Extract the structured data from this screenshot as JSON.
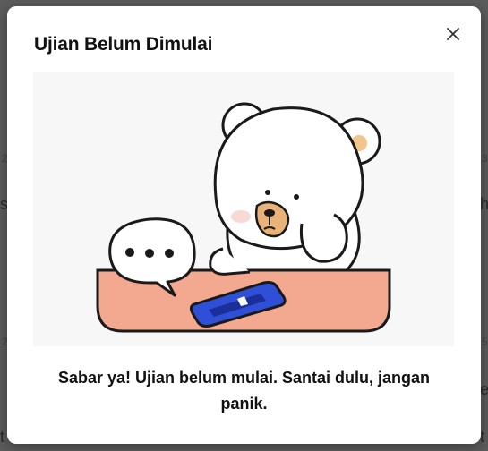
{
  "dialog": {
    "title": "Ujian Belum Dimulai",
    "message": "Sabar ya! Ujian belum mulai. Santai dulu, jangan panik.",
    "close_icon": "close-icon"
  },
  "illustration": {
    "subject": "bear-waiting-illustration",
    "icons": [
      "speech-bubble-icon",
      "phone-icon"
    ]
  },
  "colors": {
    "table": "#f3a98f",
    "phone": "#2f4fd6",
    "overlay": "#5c5c5c"
  }
}
